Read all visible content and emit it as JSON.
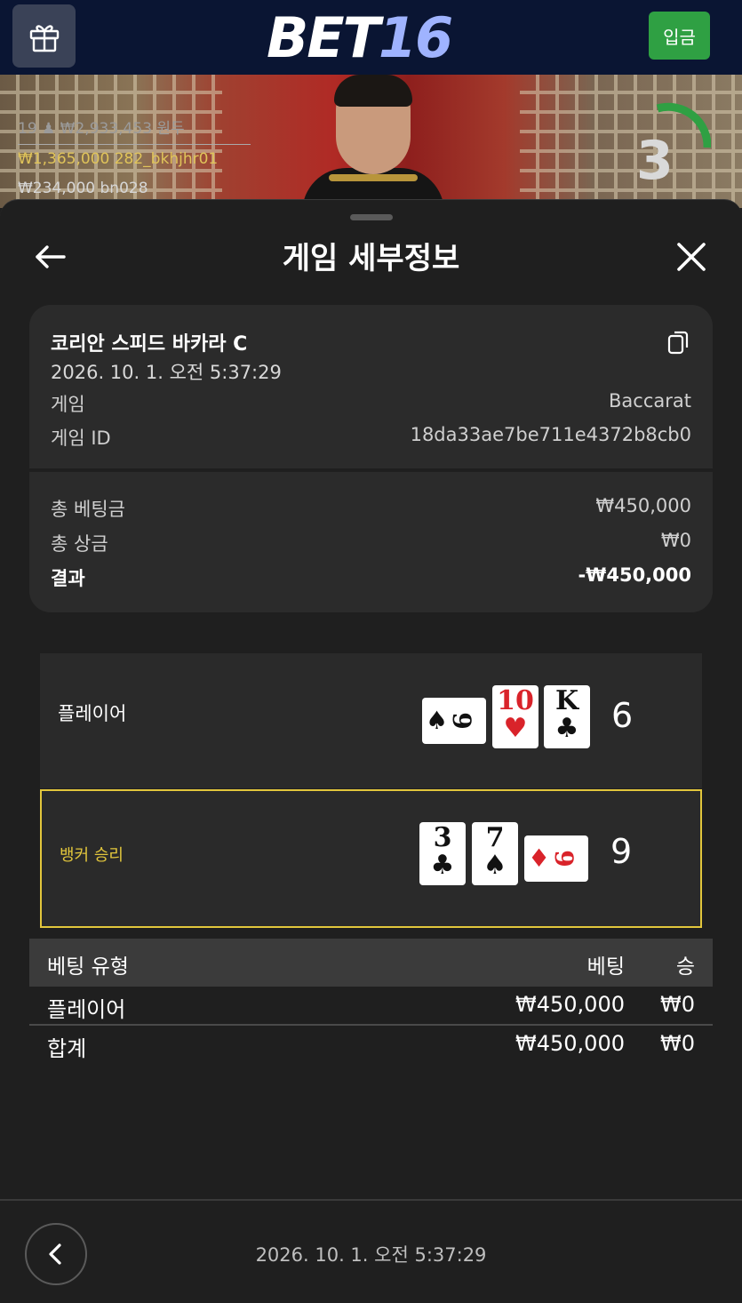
{
  "topbar": {
    "logo_text": "BET",
    "logo_num": "16",
    "deposit_label": "입금",
    "gift_icon": "gift-icon"
  },
  "video": {
    "line1": "19 ♟ ₩2,933,453 원두",
    "line2": "₩1,365,000  282_bkhjhr01",
    "line3": "₩234,000  bn028",
    "timer_value": "3"
  },
  "sheet": {
    "title": "게임 세부정보",
    "back_icon": "back-arrow-icon",
    "close_icon": "close-icon"
  },
  "details": {
    "table_name": "코리안 스피드 바카라 C",
    "datetime": "2026. 10. 1. 오전 5:37:29",
    "game_label": "게임",
    "game_value": "Baccarat",
    "game_id_label": "게임 ID",
    "game_id_value": "18da33ae7be711e4372b8cb0",
    "total_bet_label": "총 베팅금",
    "total_bet_value": "₩450,000",
    "total_win_label": "총 상금",
    "total_win_value": "₩0",
    "result_label": "결과",
    "result_value": "-₩450,000"
  },
  "hands": {
    "player": {
      "label": "플레이어",
      "score": "6",
      "cards": [
        {
          "rank": "9",
          "suit": "♠",
          "color": "black",
          "orientation": "sideways"
        },
        {
          "rank": "10",
          "suit": "♥",
          "color": "red",
          "orientation": "upright"
        },
        {
          "rank": "K",
          "suit": "♣",
          "color": "black",
          "orientation": "upright"
        }
      ]
    },
    "banker": {
      "label": "뱅커 승리",
      "score": "9",
      "cards": [
        {
          "rank": "3",
          "suit": "♣",
          "color": "black",
          "orientation": "upright"
        },
        {
          "rank": "7",
          "suit": "♠",
          "color": "black",
          "orientation": "upright"
        },
        {
          "rank": "9",
          "suit": "♦",
          "color": "red",
          "orientation": "sideways"
        }
      ]
    },
    "highlight_color": "#e2c63c"
  },
  "bets": {
    "headers": {
      "type": "베팅 유형",
      "bet": "베팅",
      "win": "승"
    },
    "rows": [
      {
        "type": "플레이어",
        "bet": "₩450,000",
        "win": "₩0"
      }
    ],
    "total": {
      "type": "합계",
      "bet": "₩450,000",
      "win": "₩0"
    }
  },
  "footer": {
    "datetime": "2026. 10. 1. 오전 5:37:29",
    "prev_icon": "chevron-left-icon"
  },
  "colors": {
    "accent_green": "#2fa043",
    "topbar_bg": "#0a1533",
    "win_gold": "#e2c63c"
  }
}
